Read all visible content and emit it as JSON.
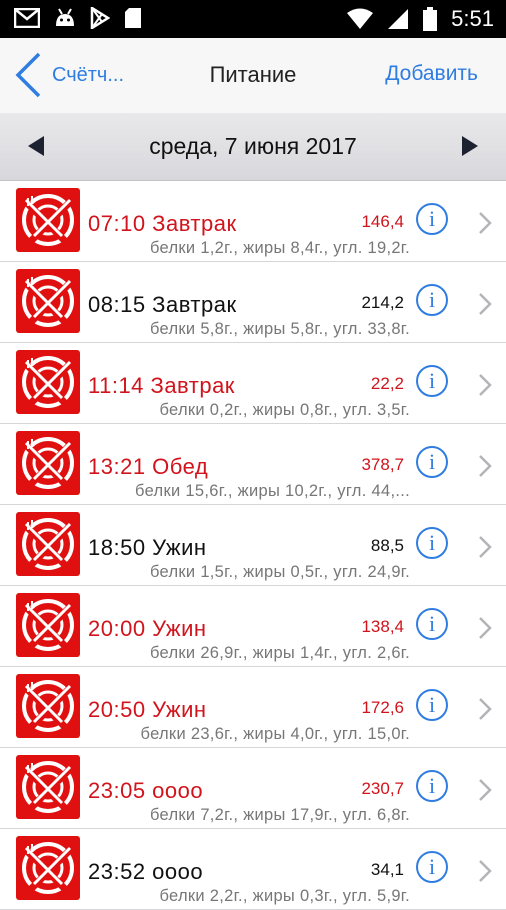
{
  "status_bar": {
    "time": "5:51"
  },
  "nav": {
    "back_label": "Счётч...",
    "title": "Питание",
    "add_label": "Добавить"
  },
  "date_bar": {
    "date": "среда, 7 июня 2017"
  },
  "colors": {
    "accent": "#2f7de1",
    "highlight_red": "#d1141c",
    "icon_red": "#e01010"
  },
  "meals": [
    {
      "title": "07:10 Завтрак",
      "calories": "146,4",
      "macros": "белки 1,2г., жиры 8,4г., угл. 19,2г.",
      "highlight": true
    },
    {
      "title": "08:15 Завтрак",
      "calories": "214,2",
      "macros": "белки 5,8г., жиры 5,8г., угл. 33,8г.",
      "highlight": false
    },
    {
      "title": "11:14 Завтрак",
      "calories": "22,2",
      "macros": "белки 0,2г., жиры 0,8г., угл. 3,5г.",
      "highlight": true
    },
    {
      "title": "13:21 Обед",
      "calories": "378,7",
      "macros": "белки 15,6г., жиры 10,2г., угл. 44,...",
      "highlight": true
    },
    {
      "title": "18:50 Ужин",
      "calories": "88,5",
      "macros": "белки 1,5г., жиры 0,5г., угл. 24,9г.",
      "highlight": false
    },
    {
      "title": "20:00 Ужин",
      "calories": "138,4",
      "macros": "белки 26,9г., жиры 1,4г., угл. 2,6г.",
      "highlight": true
    },
    {
      "title": "20:50 Ужин",
      "calories": "172,6",
      "macros": "белки 23,6г., жиры 4,0г., угл. 15,0г.",
      "highlight": true
    },
    {
      "title": "23:05 оооо",
      "calories": "230,7",
      "macros": "белки 7,2г., жиры 17,9г., угл. 6,8г.",
      "highlight": true
    },
    {
      "title": "23:52 оооо",
      "calories": "34,1",
      "macros": "белки 2,2г., жиры 0,3г., угл. 5,9г.",
      "highlight": false
    }
  ]
}
